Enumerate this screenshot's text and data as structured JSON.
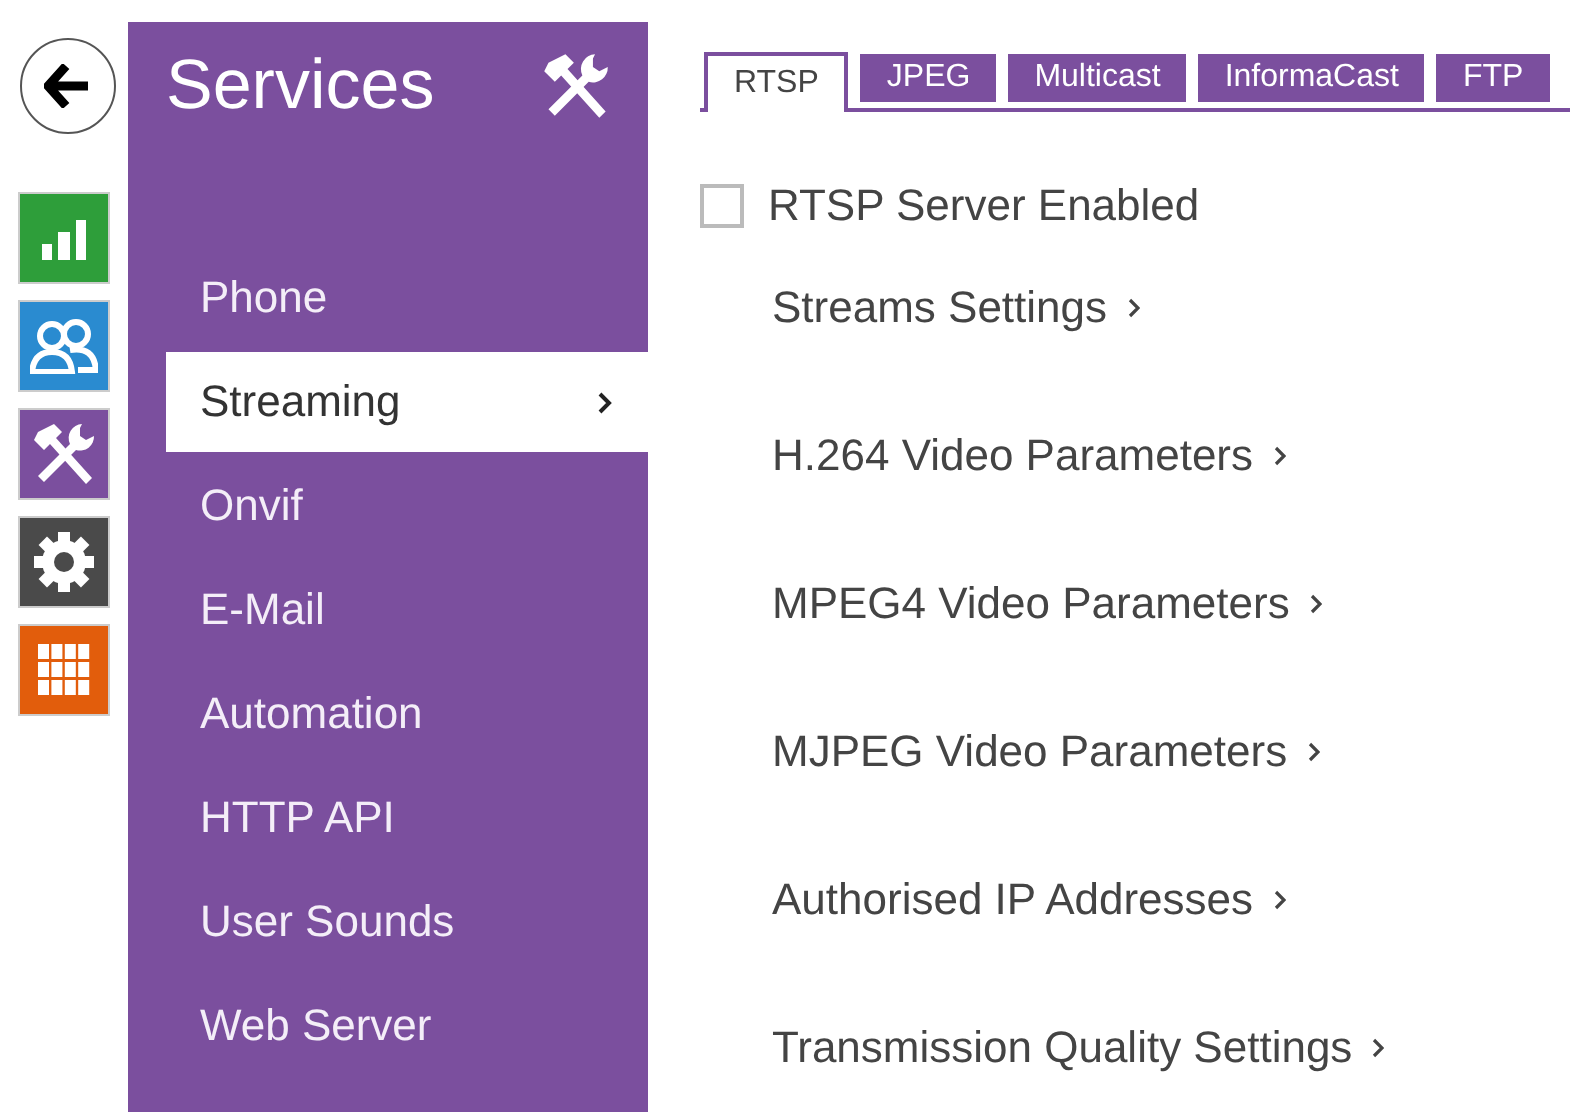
{
  "nav_icons": [
    {
      "kind": "stats",
      "color": "#2e9e3a"
    },
    {
      "kind": "users",
      "color": "#2a8bd0"
    },
    {
      "kind": "tools",
      "color": "#7b4f9e"
    },
    {
      "kind": "gear",
      "color": "#4a4a4a"
    },
    {
      "kind": "grid",
      "color": "#e25d0c"
    }
  ],
  "sidebar": {
    "title": "Services",
    "items": [
      {
        "label": "Phone",
        "selected": false
      },
      {
        "label": "Streaming",
        "selected": true
      },
      {
        "label": "Onvif",
        "selected": false
      },
      {
        "label": "E-Mail",
        "selected": false
      },
      {
        "label": "Automation",
        "selected": false
      },
      {
        "label": "HTTP API",
        "selected": false
      },
      {
        "label": "User Sounds",
        "selected": false
      },
      {
        "label": "Web Server",
        "selected": false
      }
    ]
  },
  "tabs": [
    {
      "label": "RTSP",
      "selected": true
    },
    {
      "label": "JPEG",
      "selected": false
    },
    {
      "label": "Multicast",
      "selected": false
    },
    {
      "label": "InformaCast",
      "selected": false
    },
    {
      "label": "FTP",
      "selected": false
    }
  ],
  "server_enabled": {
    "label": "RTSP Server Enabled",
    "checked": false
  },
  "sections": [
    "Streams Settings",
    "H.264 Video Parameters",
    "MPEG4 Video Parameters",
    "MJPEG Video Parameters",
    "Authorised IP Addresses",
    "Transmission Quality Settings"
  ]
}
